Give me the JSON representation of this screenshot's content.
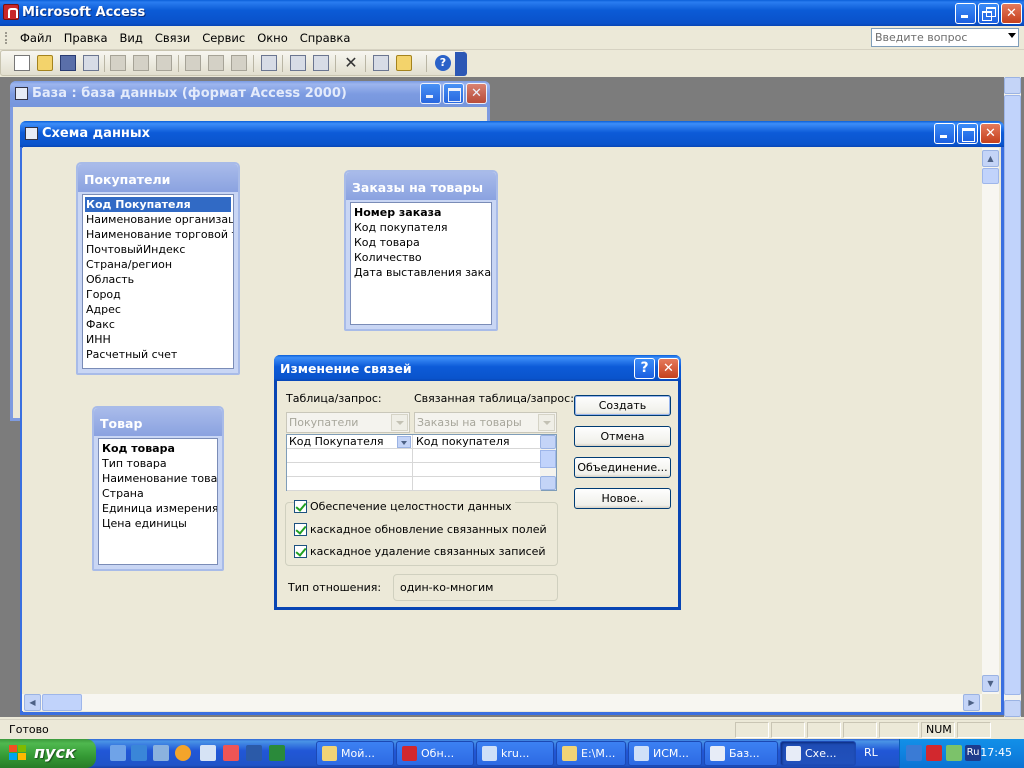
{
  "app": {
    "title": "Microsoft Access"
  },
  "menu": {
    "items": [
      "Файл",
      "Правка",
      "Вид",
      "Связи",
      "Сервис",
      "Окно",
      "Справка"
    ],
    "help_placeholder": "Введите вопрос"
  },
  "toolbar": {
    "buttons": [
      "new-icon",
      "open-icon",
      "save-icon",
      "search-icon",
      "print-icon",
      "preview-icon",
      "spelling-icon",
      "cut-icon",
      "copy-icon",
      "paste-icon",
      "show-table-icon",
      "show-direct-icon",
      "show-all-icon",
      "delete-icon",
      "new-object-icon",
      "help-icon"
    ]
  },
  "db_window": {
    "title": "База : база данных (формат Access 2000)"
  },
  "schema_window": {
    "title": "Схема данных"
  },
  "tables": [
    {
      "name": "Покупатели",
      "fields": [
        "Код Покупателя",
        "Наименование организации",
        "Наименование торговой точк",
        "ПочтовыйИндекс",
        "Страна/регион",
        "Область",
        "Город",
        "Адрес",
        "Факс",
        "ИНН",
        "Расчетный счет"
      ]
    },
    {
      "name": "Заказы на товары",
      "fields": [
        "Номер заказа",
        "Код покупателя",
        "Код товара",
        "Количество",
        "Дата выставления  заказа"
      ]
    },
    {
      "name": "Товар",
      "fields": [
        "Код товара",
        "Тип товара",
        "Наименование товара",
        "Страна",
        "Единица измерения",
        "Цена единицы"
      ]
    }
  ],
  "dialog": {
    "title": "Изменение связей",
    "help_glyph": "?",
    "close_glyph": "✕",
    "table_label": "Таблица/запрос:",
    "related_label": "Связанная таблица/запрос:",
    "table_value": "Покупатели",
    "related_value": "Заказы на товары",
    "grid": {
      "left": "Код Покупателя",
      "right": "Код покупателя"
    },
    "checks": [
      "Обеспечение целостности данных",
      "каскадное обновление связанных полей",
      "каскадное удаление связанных записей"
    ],
    "relation_type_label": "Тип отношения:",
    "relation_type_value": "один-ко-многим",
    "buttons": [
      "Создать",
      "Отмена",
      "Объединение...",
      "Новое.."
    ]
  },
  "status": {
    "ready": "Готово",
    "num": "NUM"
  },
  "taskbar": {
    "start": "пуск",
    "tasks": [
      "Мой...",
      "Обн...",
      "kru...",
      "E:\\М...",
      "ИСМ...",
      "Баз...",
      "Схе..."
    ],
    "lang": "RL",
    "tray_lang": "Ru",
    "clock": "17:45"
  }
}
